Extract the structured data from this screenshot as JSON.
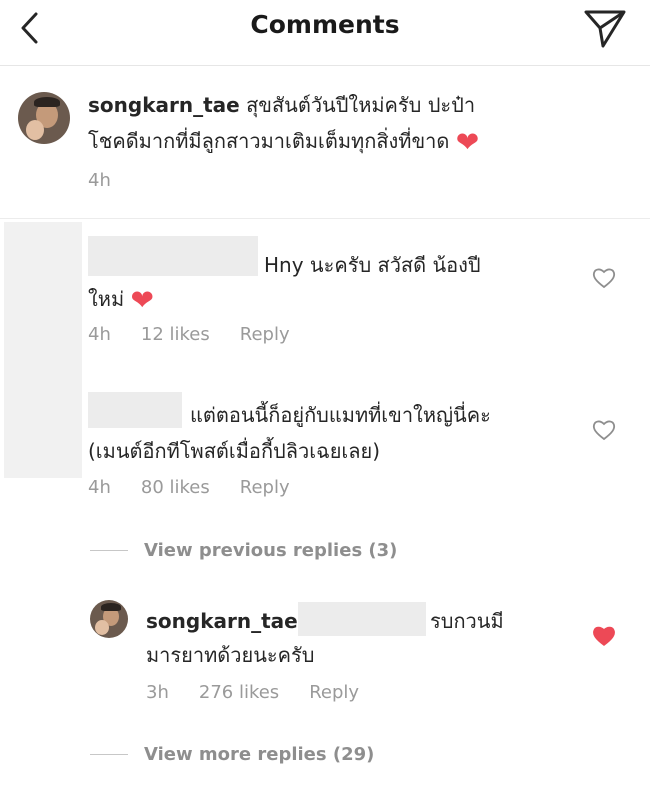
{
  "header": {
    "title": "Comments"
  },
  "caption": {
    "username": "songkarn_tae",
    "line1": "สุขสันต์วันปีใหม่ครับ ปะป๋า",
    "line2": "โชคดีมากที่มีลูกสาวมาเติมเต็มทุกสิ่งที่ขาด",
    "emoji": "❤️",
    "time": "4h"
  },
  "comments": [
    {
      "line1": "Hny นะครับ สวัสดี น้องปี",
      "line2": "ใหม่",
      "emoji": "❤️",
      "time": "4h",
      "likes": "12 likes",
      "reply": "Reply"
    },
    {
      "line1": "แต่ตอนนี้ก็อยู่กับแมทที่เขาใหญ่นี่คะ",
      "line2": "(เมนต์อีกทีโพสต์เมื่อกี้ปลิวเฉยเลย)",
      "time": "4h",
      "likes": "80 likes",
      "reply": "Reply"
    }
  ],
  "view_previous": "View previous replies (3)",
  "reply": {
    "username": "songkarn_tae",
    "line1_tail": "รบกวนมี",
    "line2": "มารยาทด้วยนะครับ",
    "time": "3h",
    "likes": "276 likes",
    "reply": "Reply",
    "liked": true,
    "heart_color": "#ed4956"
  },
  "view_more": "View more replies (29)"
}
